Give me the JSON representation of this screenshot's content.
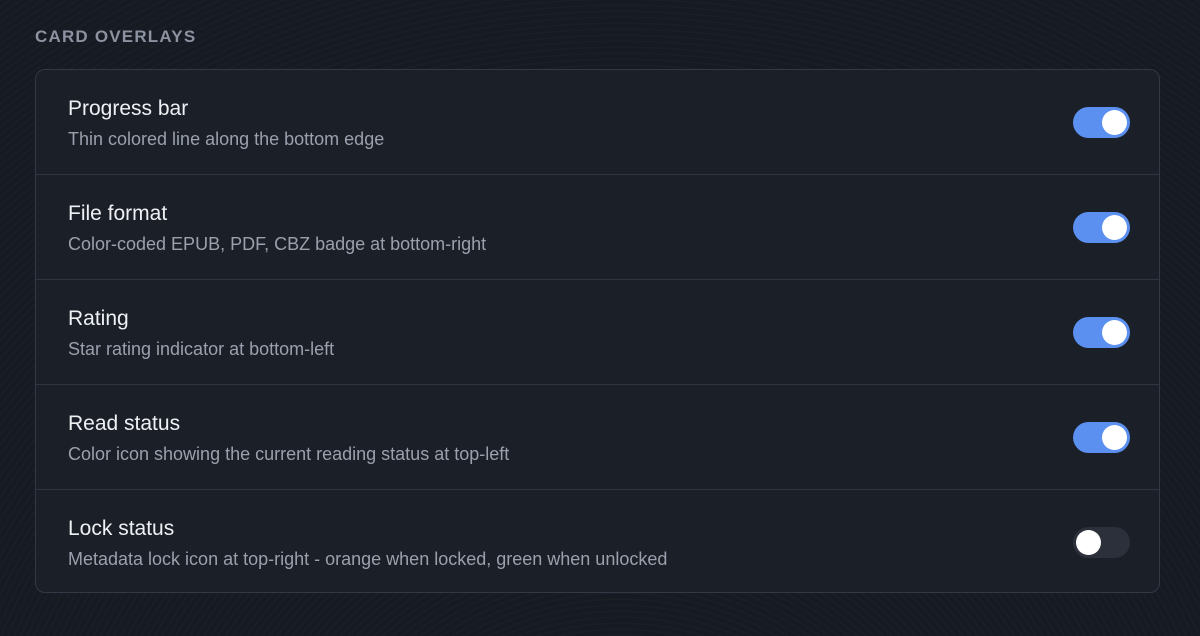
{
  "section": {
    "title": "CARD OVERLAYS"
  },
  "settings": [
    {
      "title": "Progress bar",
      "description": "Thin colored line along the bottom edge",
      "enabled": true
    },
    {
      "title": "File format",
      "description": "Color-coded EPUB, PDF, CBZ badge at bottom-right",
      "enabled": true
    },
    {
      "title": "Rating",
      "description": "Star rating indicator at bottom-left",
      "enabled": true
    },
    {
      "title": "Read status",
      "description": "Color icon showing the current reading status at top-left",
      "enabled": true
    },
    {
      "title": "Lock status",
      "description": "Metadata lock icon at top-right - orange when locked, green when unlocked",
      "enabled": false
    }
  ],
  "colors": {
    "toggle_on": "#5b8ff0",
    "toggle_off": "#2b303b"
  }
}
